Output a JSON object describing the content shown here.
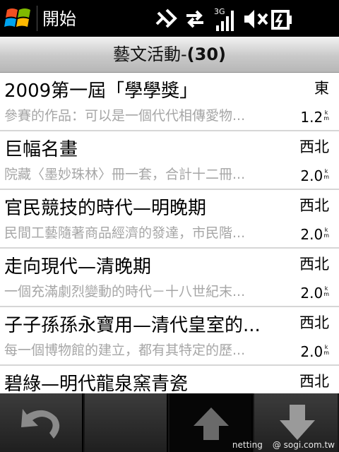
{
  "status_bar": {
    "start_label": "開始",
    "network_label": "3G",
    "icons": [
      "windows-logo",
      "bluetooth-icon",
      "data-transfer-icon",
      "signal-strength-icon",
      "volume-muted-icon",
      "battery-charging-icon"
    ]
  },
  "header": {
    "title": "藝文活動-",
    "count": "(30)"
  },
  "items": [
    {
      "title": "2009第一屆「學學獎」",
      "description": "參賽的作品：可以是一個代代相傳愛物...",
      "direction": "東",
      "distance": "1.2",
      "unit_top": "k",
      "unit_bottom": "m"
    },
    {
      "title": "巨幅名畫",
      "description": "院藏〈墨妙珠林〉冊一套，合計十二冊...",
      "direction": "西北",
      "distance": "2.0",
      "unit_top": "k",
      "unit_bottom": "m"
    },
    {
      "title": "官民競技的時代—明晚期",
      "description": "民間工藝隨著商品經濟的發達，市民階...",
      "direction": "西北",
      "distance": "2.0",
      "unit_top": "k",
      "unit_bottom": "m"
    },
    {
      "title": "走向現代—清晚期",
      "description": "一個充滿劇烈變動的時代－十八世紀末...",
      "direction": "西北",
      "distance": "2.0",
      "unit_top": "k",
      "unit_bottom": "m"
    },
    {
      "title": "子子孫孫永寶用—清代皇室的...",
      "description": "每一個博物館的建立，都有其特定的歷...",
      "direction": "西北",
      "distance": "2.0",
      "unit_top": "k",
      "unit_bottom": "m"
    },
    {
      "title": "碧綠—明代龍泉窯青瓷",
      "description": "",
      "direction": "西北",
      "distance": "",
      "unit_top": "",
      "unit_bottom": ""
    }
  ],
  "toolbar": {
    "buttons": [
      "back-icon",
      "",
      "scroll-up-icon",
      "scroll-down-icon"
    ]
  },
  "watermark": {
    "left": "netting",
    "right": "@ sogi.com.tw"
  },
  "colors": {
    "status_bar_bg": "#000000",
    "description_text": "#a6a6a6",
    "divider": "#d6d6d6"
  }
}
